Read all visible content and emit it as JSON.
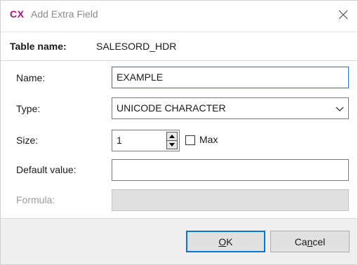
{
  "window": {
    "logo": "CX",
    "title": "Add Extra Field"
  },
  "table": {
    "label": "Table name:",
    "value": "SALESORD_HDR"
  },
  "fields": {
    "name": {
      "label": "Name:",
      "value": "EXAMPLE"
    },
    "type": {
      "label": "Type:",
      "value": "UNICODE CHARACTER"
    },
    "size": {
      "label": "Size:",
      "value": "1",
      "max_label": "Max",
      "max_checked": false
    },
    "default_value": {
      "label": "Default value:",
      "value": ""
    },
    "formula": {
      "label": "Formula:",
      "value": ""
    }
  },
  "buttons": {
    "ok": {
      "mnemonic": "O",
      "rest": "K"
    },
    "cancel": {
      "prefix": "Ca",
      "mnemonic": "n",
      "rest": "cel"
    }
  },
  "colors": {
    "logo": "#b0127a",
    "focus_border": "#2b6fd6",
    "default_button_border": "#0078d7"
  }
}
